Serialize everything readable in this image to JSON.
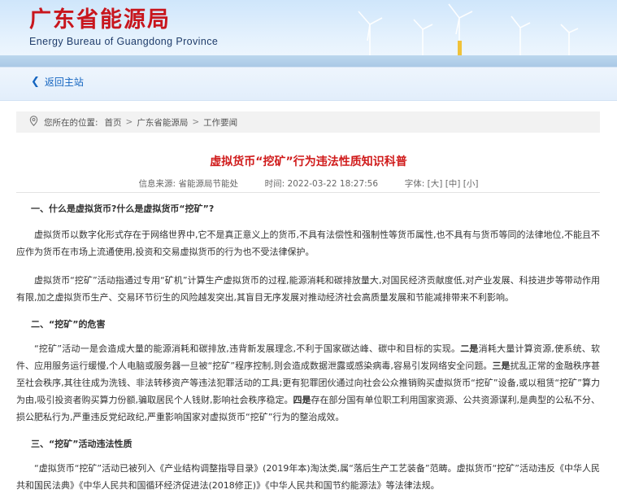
{
  "site": {
    "title_cn": "广东省能源局",
    "title_en": "Energy Bureau of Guangdong Province"
  },
  "nav": {
    "back_label": "返回主站"
  },
  "breadcrumb": {
    "prefix": "您所在的位置:",
    "items": [
      "首页",
      "广东省能源局",
      "工作要闻"
    ],
    "separator": ">"
  },
  "article": {
    "title": "虚拟货币“挖矿”行为违法性质知识科普",
    "source_label": "信息来源:",
    "source": "省能源局节能处",
    "time_label": "时间:",
    "time": "2022-03-22 18:27:56",
    "font_label": "字体:",
    "font_sizes": [
      "[大]",
      "[中]",
      "[小]"
    ],
    "h1": "一、什么是虚拟货币?什么是虚拟货币“挖矿”?",
    "p1": "虚拟货币以数字化形式存在于网络世界中,它不是真正意义上的货币,不具有法偿性和强制性等货币属性,也不具有与货币等同的法律地位,不能且不应作为货币在市场上流通使用,投资和交易虚拟货币的行为也不受法律保护。",
    "p2": "虚拟货币“挖矿”活动指通过专用“矿机”计算生产虚拟货币的过程,能源消耗和碳排放量大,对国民经济贡献度低,对产业发展、科技进步等带动作用有限,加之虚拟货币生产、交易环节衍生的风险越发突出,其盲目无序发展对推动经济社会高质量发展和节能减排带来不利影响。",
    "h2": "二、“挖矿”的危害",
    "p3_a": "“挖矿”活动一是会造成大量的能源消耗和碳排放,违背新发展理念,不利于国家碳达峰、碳中和目标的实现。",
    "p3_b": "二是",
    "p3_c": "消耗大量计算资源,使系统、软件、应用服务运行缓慢,个人电脑或服务器一旦被“挖矿”程序控制,则会造成数据泄露或感染病毒,容易引发网络安全问题。",
    "p3_d": "三是",
    "p3_e": "扰乱正常的金融秩序甚至社会秩序,其往往成为洗钱、非法转移资产等违法犯罪活动的工具;更有犯罪团伙通过向社会公众推销购买虚拟货币“挖矿”设备,或以租赁“挖矿”算力为由,吸引投资者购买算力份额,骗取居民个人钱财,影响社会秩序稳定。",
    "p3_f": "四是",
    "p3_g": "存在部分国有单位职工利用国家资源、公共资源谋利,是典型的公私不分、损公肥私行为,严重违反党纪政纪,严重影响国家对虚拟货币“挖矿”行为的整治成效。",
    "h3": "三、“挖矿”活动违法性质",
    "p4": "“虚拟货币“挖矿”活动已被列入《产业结构调整指导目录》(2019年本)淘汰类,属“落后生产工艺装备”范畴。虚拟货币“挖矿”活动违反《中华人民共和国民法典》《中华人民共和国循环经济促进法(2018修正)》《中华人民共和国节约能源法》等法律法规。"
  }
}
